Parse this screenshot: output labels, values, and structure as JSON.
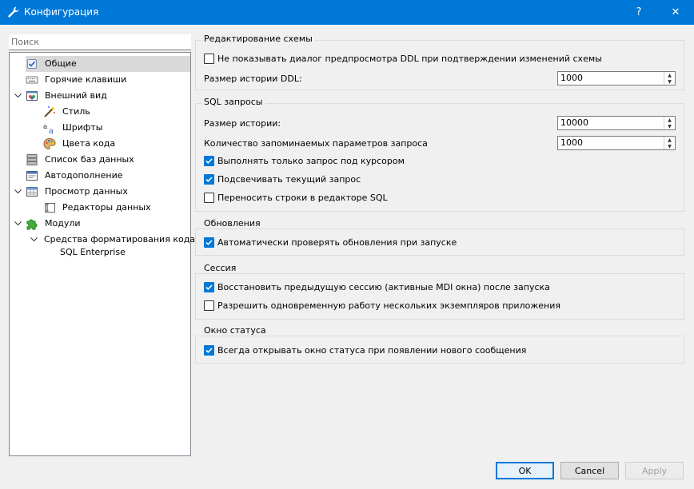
{
  "window": {
    "title": "Конфигурация",
    "help": "?",
    "close": "✕"
  },
  "search": {
    "placeholder": "Поиск"
  },
  "tree": [
    {
      "label": "Общие",
      "icon": "general-icon",
      "selected": true
    },
    {
      "label": "Горячие клавиши",
      "icon": "keyboard-icon"
    },
    {
      "label": "Внешний вид",
      "icon": "appearance-icon",
      "expanded": true
    },
    {
      "label": "Стиль",
      "icon": "style-wand-icon"
    },
    {
      "label": "Шрифты",
      "icon": "fonts-icon"
    },
    {
      "label": "Цвета кода",
      "icon": "palette-icon"
    },
    {
      "label": "Список баз данных",
      "icon": "database-list-icon"
    },
    {
      "label": "Автодополнение",
      "icon": "autocomplete-icon"
    },
    {
      "label": "Просмотр данных",
      "icon": "data-browser-icon",
      "expanded": true
    },
    {
      "label": "Редакторы данных",
      "icon": "data-editors-icon"
    },
    {
      "label": "Модули",
      "icon": "plugins-puzzle-icon",
      "expanded": true
    },
    {
      "label": "Средства форматирования кода",
      "icon": "",
      "expanded": true
    },
    {
      "label": "SQL Enterprise",
      "icon": ""
    }
  ],
  "groups": {
    "schema": {
      "title": "Редактирование схемы",
      "ddl_preview": {
        "label": "Не показывать диалог предпросмотра DDL при подтверждении изменений схемы",
        "checked": false
      },
      "ddl_history_label": "Размер истории DDL:",
      "ddl_history_value": "1000"
    },
    "sql": {
      "title": "SQL запросы",
      "history_label": "Размер истории:",
      "history_value": "10000",
      "params_label": "Количество запоминаемых параметров запроса",
      "params_value": "1000",
      "exec_under_cursor": {
        "label": "Выполнять только запрос под курсором",
        "checked": true
      },
      "highlight_current": {
        "label": "Подсвечивать текущий запрос",
        "checked": true
      },
      "wrap_lines": {
        "label": "Переносить строки в редакторе SQL",
        "checked": false
      }
    },
    "updates": {
      "title": "Обновления",
      "auto_check": {
        "label": "Автоматически проверять обновления при запуске",
        "checked": true
      }
    },
    "session": {
      "title": "Сессия",
      "restore": {
        "label": "Восстановить предыдущую сессию (активные MDI окна) после запуска",
        "checked": true
      },
      "multi_instance": {
        "label": "Разрешить одновременную работу нескольких экземпляров приложения",
        "checked": false
      }
    },
    "status": {
      "title": "Окно статуса",
      "always_open": {
        "label": "Всегда открывать окно статуса при появлении нового сообщения",
        "checked": true
      }
    }
  },
  "buttons": {
    "ok": "OK",
    "cancel": "Cancel",
    "apply": "Apply"
  },
  "colors": {
    "accent": "#0078d7",
    "titlebar_text": "#ffffff",
    "disabled_text": "#a0a0a0"
  }
}
